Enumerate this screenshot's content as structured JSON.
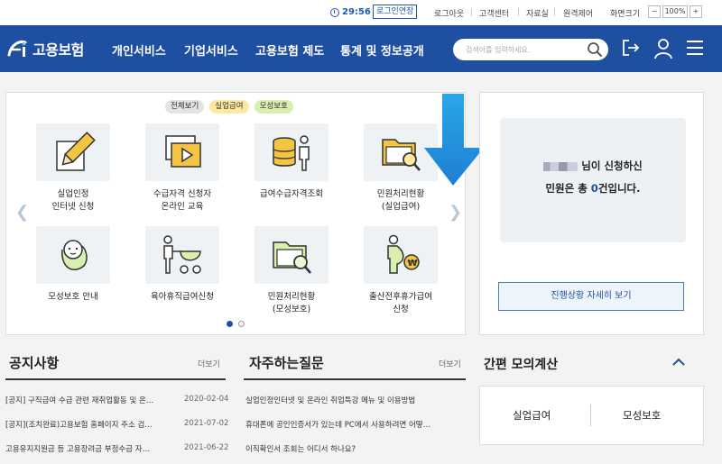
{
  "topbar": {
    "timer": "29:56",
    "extend_label": "로그인연장",
    "logout": "로그아웃",
    "customer_center": "고객센터",
    "resources": "자료실",
    "remote": "원격제어",
    "zoom_label": "화면크기",
    "zoom_minus": "−",
    "zoom_value": "100%",
    "zoom_plus": "+"
  },
  "header": {
    "logo_text": "고용보험",
    "nav": [
      "개인서비스",
      "기업서비스",
      "고용보험 제도",
      "통계 및 정보공개"
    ],
    "search_placeholder": "검색어를 입력하세요."
  },
  "services": {
    "chips": [
      "전체보기",
      "실업급여",
      "모성보호"
    ],
    "items": [
      {
        "label": "실업인정\n인터넷 신청",
        "icon": "pencil-icon"
      },
      {
        "label": "수급자격 신청자\n온라인 교육",
        "icon": "video-play-icon"
      },
      {
        "label": "급여수급자격조회",
        "icon": "coins-person-icon"
      },
      {
        "label": "민원처리현황\n(실업급여)",
        "icon": "folder-search-icon"
      },
      {
        "label": "모성보호 안내",
        "icon": "baby-icon"
      },
      {
        "label": "육아휴직급여신청",
        "icon": "stroller-icon"
      },
      {
        "label": "민원처리현황\n(모성보호)",
        "icon": "folder-search-icon"
      },
      {
        "label": "출산전후휴가급여\n신청",
        "icon": "pregnant-coin-icon"
      }
    ]
  },
  "status": {
    "line1_suffix": "님이 신청하신",
    "line2_prefix": "민원은 총 ",
    "count": "0",
    "line2_suffix": "건입니다.",
    "detail_button": "진행상황 자세히 보기"
  },
  "notices": {
    "title": "공지사항",
    "more": "더보기",
    "rows": [
      {
        "text": "[공지] 구직급여 수급 관련 재취업활동 및 온…",
        "date": "2020-02-04"
      },
      {
        "text": "[공지](조치완료)고용보험 홈페이지 주소 검…",
        "date": "2021-07-02"
      },
      {
        "text": "고용유지지원금 등 고용장려금 부정수급 자…",
        "date": "2021-06-22"
      }
    ]
  },
  "faq": {
    "title": "자주하는질문",
    "more": "더보기",
    "rows": [
      "실업인정인터넷 및 온라인 취업특강 메뉴 및 이용방법",
      "휴대폰에 공인인증서가 있는데 PC에서 사용하려면 어떻…",
      "이직확인서 조회는 어디서 하나요?"
    ]
  },
  "calc": {
    "title": "간편 모의계산",
    "options": [
      "실업급여",
      "모성보호"
    ]
  },
  "colors": {
    "brand": "#1e4fa0",
    "chip_unemployment": "#fde9a0",
    "chip_maternity": "#d9efb0"
  }
}
